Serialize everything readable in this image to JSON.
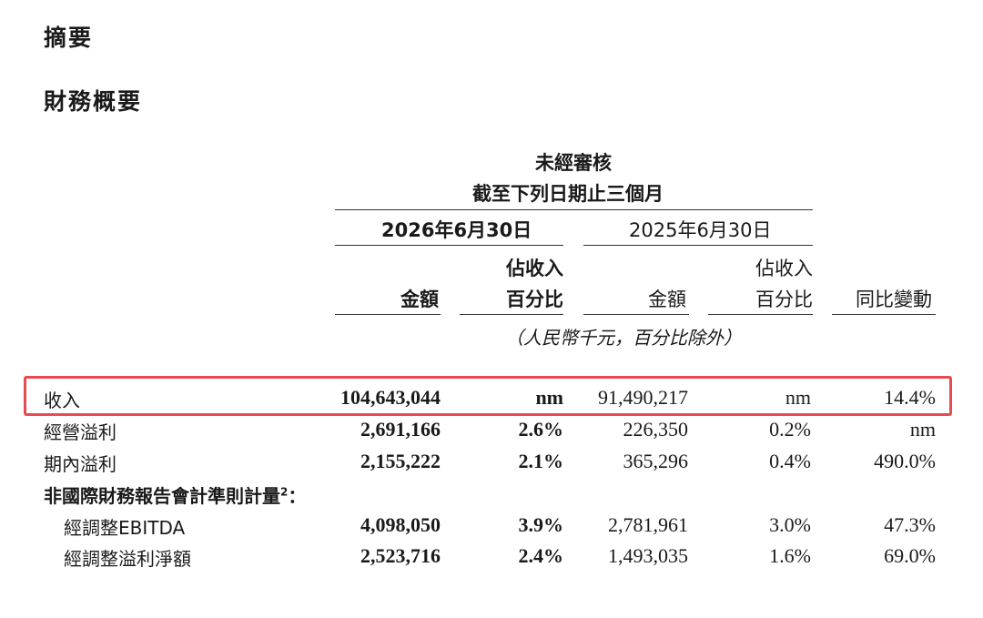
{
  "headings": {
    "summary": "摘要",
    "financial_summary": "財務概要"
  },
  "table": {
    "header_unaudited": "未經審核",
    "header_period": "截至下列日期止三個月",
    "date_current": "2026年6月30日",
    "date_prior": "2025年6月30日",
    "col_amount": "金額",
    "col_pct_line1": "佔收入",
    "col_pct_line2": "百分比",
    "col_yoy": "同比變動",
    "unit_note": "（人民幣千元，百分比除外）",
    "rows": [
      {
        "label": "收入",
        "amount_2026": "104,643,044",
        "pct_2026": "nm",
        "amount_2025": "91,490,217",
        "pct_2025": "nm",
        "yoy": "14.4%"
      },
      {
        "label": "經營溢利",
        "amount_2026": "2,691,166",
        "pct_2026": "2.6%",
        "amount_2025": "226,350",
        "pct_2025": "0.2%",
        "yoy": "nm"
      },
      {
        "label": "期內溢利",
        "amount_2026": "2,155,222",
        "pct_2026": "2.1%",
        "amount_2025": "365,296",
        "pct_2025": "0.4%",
        "yoy": "490.0%"
      }
    ],
    "non_ifrs_label": "非國際財務報告會計準則計量",
    "non_ifrs_sup": "2",
    "non_ifrs_colon": "：",
    "sub_rows": [
      {
        "label": "經調整EBITDA",
        "amount_2026": "4,098,050",
        "pct_2026": "3.9%",
        "amount_2025": "2,781,961",
        "pct_2025": "3.0%",
        "yoy": "47.3%"
      },
      {
        "label": "經調整溢利淨額",
        "amount_2026": "2,523,716",
        "pct_2026": "2.4%",
        "amount_2025": "1,493,035",
        "pct_2025": "1.6%",
        "yoy": "69.0%"
      }
    ]
  },
  "highlight_color": "#e84a52"
}
